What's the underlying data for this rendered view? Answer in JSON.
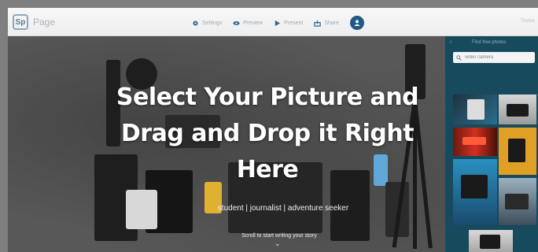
{
  "app": {
    "logo_text": "Sp",
    "name": "Page"
  },
  "nav": {
    "items": [
      {
        "label": "Settings",
        "icon": "gear-icon"
      },
      {
        "label": "Preview",
        "icon": "eye-icon"
      },
      {
        "label": "Present",
        "icon": "play-icon"
      },
      {
        "label": "Share",
        "icon": "share-icon"
      }
    ],
    "avatar_icon": "user-avatar-icon",
    "theme_label": "Theme"
  },
  "hero": {
    "title": "Select Your Picture and Drag and Drop it Right Here",
    "tagline": "student | journalist | adventure seeker",
    "scroll_hint": "Scroll to start writing your story",
    "scroll_arrow": "⌄"
  },
  "photo_panel": {
    "back_arrow": "‹",
    "title": "Find free photos",
    "search_value": "video camera",
    "search_icon": "search-icon"
  },
  "colors": {
    "topbar": "#f1f1f1",
    "panel": "#174a5c",
    "avatar": "#1f5a84",
    "nav_text": "#9ca9b4"
  }
}
